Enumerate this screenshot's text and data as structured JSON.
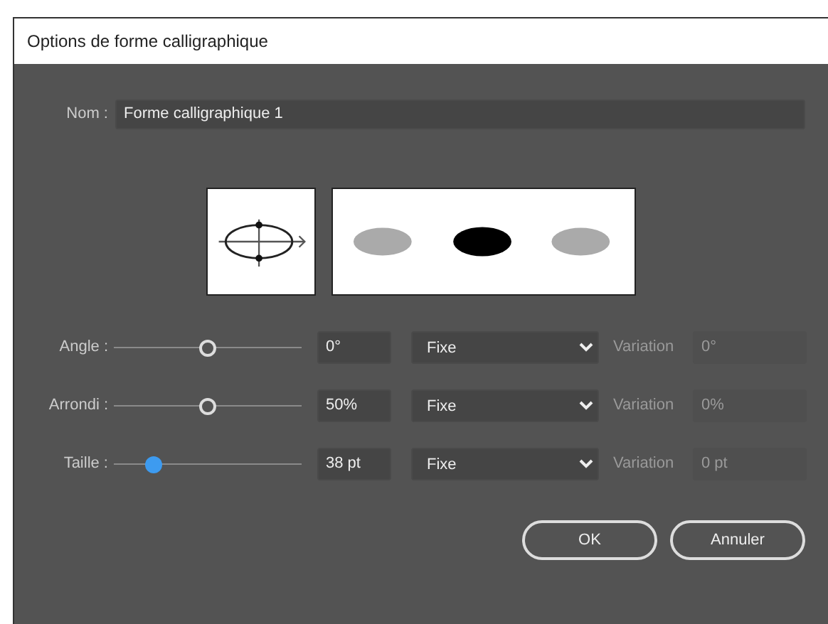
{
  "window": {
    "title": "Options de forme calligraphique"
  },
  "name_field": {
    "label": "Nom :",
    "value": "Forme calligraphique 1"
  },
  "rows": [
    {
      "label": "Angle :",
      "level": 0.5,
      "active": false,
      "value": "0°",
      "mode": "Fixe",
      "variation_label": "Variation",
      "variation_value": "0°",
      "variation_disabled": true
    },
    {
      "label": "Arrondi :",
      "level": 0.5,
      "active": false,
      "value": "50%",
      "mode": "Fixe",
      "variation_label": "Variation",
      "variation_value": "0%",
      "variation_disabled": true
    },
    {
      "label": "Taille :",
      "level": 0.2,
      "active": true,
      "value": "38 pt",
      "mode": "Fixe",
      "variation_label": "Variation",
      "variation_value": "0 pt",
      "variation_disabled": true
    }
  ],
  "buttons": [
    "OK",
    "Annuler"
  ]
}
